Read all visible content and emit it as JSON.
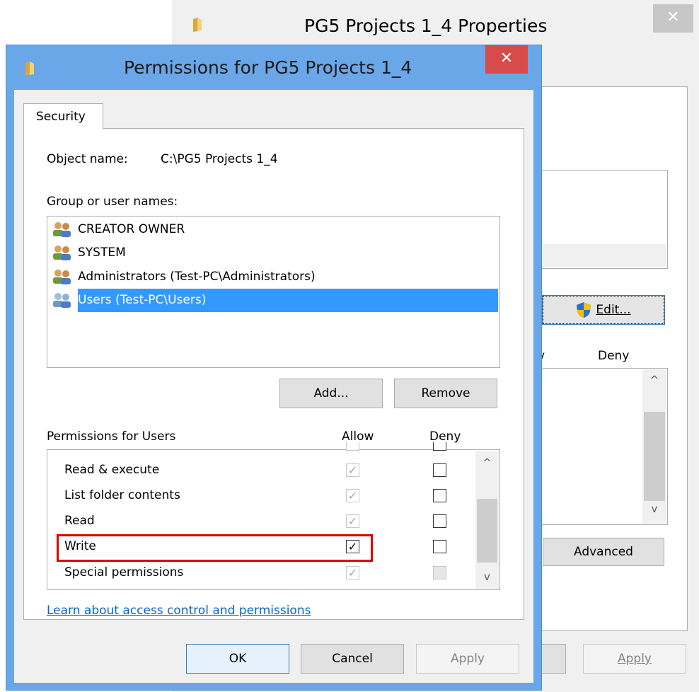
{
  "back_window": {
    "title": "PG5 Projects 1_4 Properties",
    "close_glyph": "✕",
    "edit_button": "Edit...",
    "col_allow_fragment": "v",
    "col_deny": "Deny",
    "advanced_button": "Advanced",
    "cancel_fragment": "l",
    "apply_button": "Apply",
    "scroll_up": "^",
    "scroll_down": "v"
  },
  "dialog": {
    "title": "Permissions for PG5 Projects 1_4",
    "close_glyph": "✕",
    "tab": "Security",
    "object_name_label": "Object name:",
    "object_name_value": "C:\\PG5 Projects 1_4",
    "group_label": "Group or user names:",
    "groups": [
      {
        "name": "CREATOR OWNER",
        "selected": false
      },
      {
        "name": "SYSTEM",
        "selected": false
      },
      {
        "name": "Administrators (Test-PC\\Administrators)",
        "selected": false
      },
      {
        "name": "Users (Test-PC\\Users)",
        "selected": true
      }
    ],
    "add_button": "Add...",
    "remove_button": "Remove",
    "permissions_label": "Permissions for Users",
    "allow_label": "Allow",
    "deny_label": "Deny",
    "permissions": [
      {
        "name": "Read & execute",
        "allow": true,
        "allow_disabled": true,
        "deny": false,
        "deny_disabled": false
      },
      {
        "name": "List folder contents",
        "allow": true,
        "allow_disabled": true,
        "deny": false,
        "deny_disabled": false
      },
      {
        "name": "Read",
        "allow": true,
        "allow_disabled": true,
        "deny": false,
        "deny_disabled": false
      },
      {
        "name": "Write",
        "allow": true,
        "allow_disabled": false,
        "deny": false,
        "deny_disabled": false,
        "highlighted": true
      },
      {
        "name": "Special permissions",
        "allow": true,
        "allow_disabled": true,
        "deny": false,
        "deny_disabled": true
      }
    ],
    "scroll_up": "^",
    "scroll_down": "v",
    "learn_link": "Learn about access control and permissions",
    "ok_button": "OK",
    "cancel_button": "Cancel",
    "apply_button": "Apply"
  },
  "colors": {
    "title_bar": "#6aa7e8",
    "close_red": "#d74b4b",
    "selection": "#3399ff",
    "highlight": "#e00000",
    "link": "#0066cc"
  },
  "icons": {
    "folder": "folder-icon",
    "users": "users-group-icon",
    "uac_shield": "uac-shield-icon",
    "checkmark": "✓"
  }
}
